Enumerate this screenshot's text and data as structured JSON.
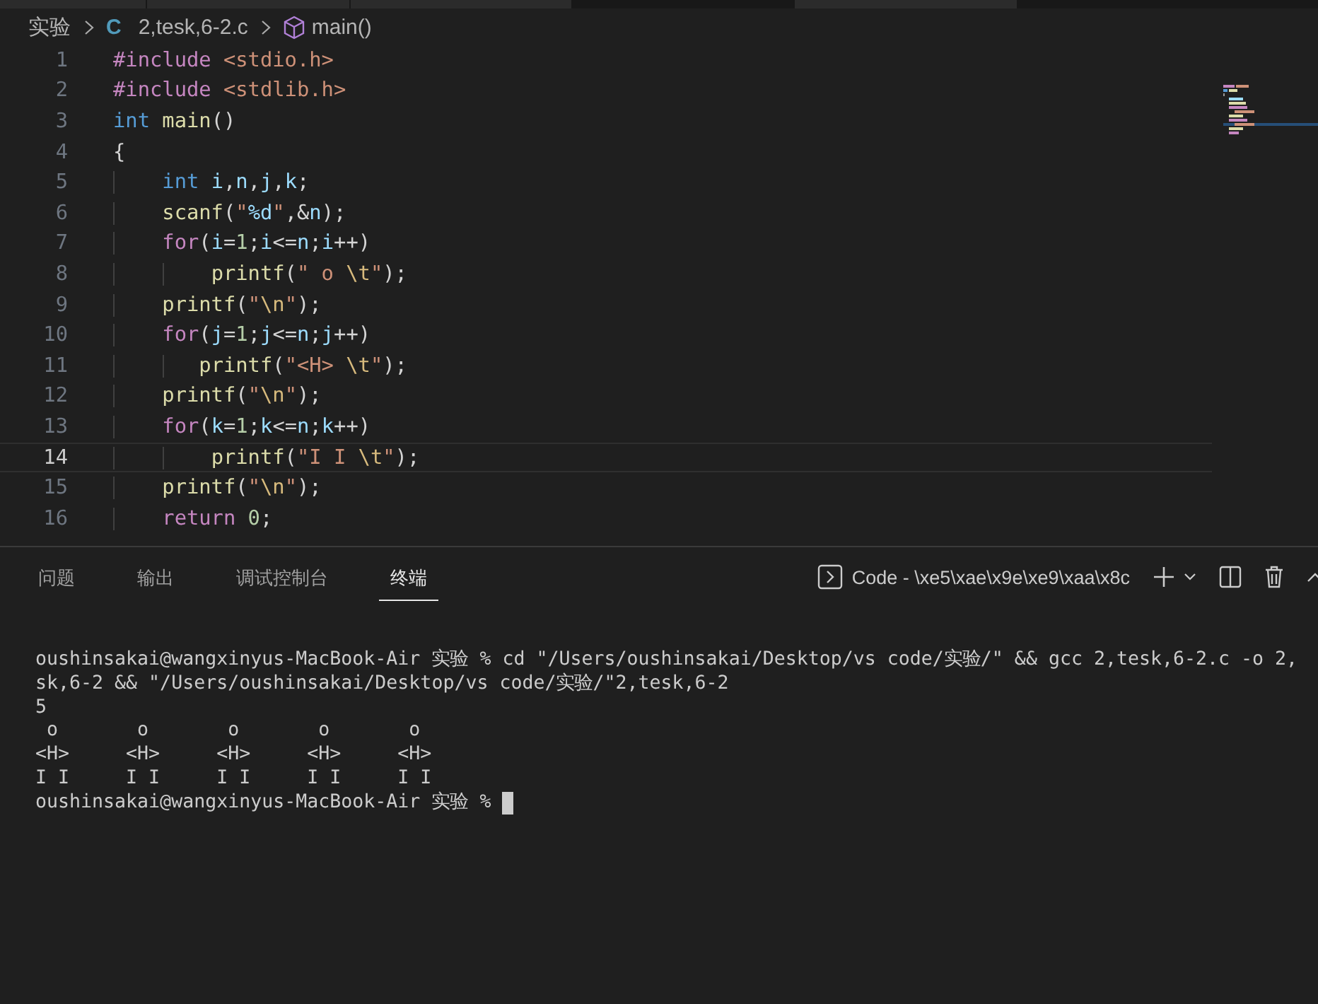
{
  "breadcrumb": {
    "folder": "实验",
    "file_icon": "C",
    "file": "2,tesk,6-2.c",
    "symbol": "main()"
  },
  "editor": {
    "lines": [
      {
        "number": "1",
        "current": false,
        "tokens": [
          {
            "kind": "directive",
            "text": "#include"
          },
          {
            "kind": "header",
            "text": " <stdio.h>"
          }
        ]
      },
      {
        "number": "2",
        "current": false,
        "tokens": [
          {
            "kind": "directive",
            "text": "#include"
          },
          {
            "kind": "header",
            "text": " <stdlib.h>"
          }
        ]
      },
      {
        "number": "3",
        "current": false,
        "tokens": [
          {
            "kind": "type",
            "text": "int"
          },
          {
            "kind": "func",
            "text": " main"
          },
          {
            "kind": "plain",
            "text": "()"
          }
        ]
      },
      {
        "number": "4",
        "current": false,
        "tokens": [
          {
            "kind": "plain",
            "text": "{"
          }
        ]
      },
      {
        "number": "5",
        "current": false,
        "tokens": [
          {
            "kind": "type",
            "text": "    int"
          },
          {
            "kind": "var",
            "text": " i"
          },
          {
            "kind": "plain",
            "text": ","
          },
          {
            "kind": "var",
            "text": "n"
          },
          {
            "kind": "plain",
            "text": ","
          },
          {
            "kind": "var",
            "text": "j"
          },
          {
            "kind": "plain",
            "text": ","
          },
          {
            "kind": "var",
            "text": "k"
          },
          {
            "kind": "plain",
            "text": ";"
          }
        ]
      },
      {
        "number": "6",
        "current": false,
        "tokens": [
          {
            "kind": "func",
            "text": "    scanf"
          },
          {
            "kind": "plain",
            "text": "("
          },
          {
            "kind": "string",
            "text": "\""
          },
          {
            "kind": "var",
            "text": "%d"
          },
          {
            "kind": "string",
            "text": "\""
          },
          {
            "kind": "plain",
            "text": ",&"
          },
          {
            "kind": "var",
            "text": "n"
          },
          {
            "kind": "plain",
            "text": ");"
          }
        ]
      },
      {
        "number": "7",
        "current": false,
        "tokens": [
          {
            "kind": "control",
            "text": "    for"
          },
          {
            "kind": "plain",
            "text": "("
          },
          {
            "kind": "var",
            "text": "i"
          },
          {
            "kind": "plain",
            "text": "="
          },
          {
            "kind": "number",
            "text": "1"
          },
          {
            "kind": "plain",
            "text": ";"
          },
          {
            "kind": "var",
            "text": "i"
          },
          {
            "kind": "plain",
            "text": "<="
          },
          {
            "kind": "var",
            "text": "n"
          },
          {
            "kind": "plain",
            "text": ";"
          },
          {
            "kind": "var",
            "text": "i"
          },
          {
            "kind": "plain",
            "text": "++)"
          }
        ]
      },
      {
        "number": "8",
        "current": false,
        "tokens": [
          {
            "kind": "func",
            "text": "        printf"
          },
          {
            "kind": "plain",
            "text": "("
          },
          {
            "kind": "string",
            "text": "\" o "
          },
          {
            "kind": "escape",
            "text": "\\t"
          },
          {
            "kind": "string",
            "text": "\""
          },
          {
            "kind": "plain",
            "text": ");"
          }
        ]
      },
      {
        "number": "9",
        "current": false,
        "tokens": [
          {
            "kind": "func",
            "text": "    printf"
          },
          {
            "kind": "plain",
            "text": "("
          },
          {
            "kind": "string",
            "text": "\""
          },
          {
            "kind": "escape",
            "text": "\\n"
          },
          {
            "kind": "string",
            "text": "\""
          },
          {
            "kind": "plain",
            "text": ");"
          }
        ]
      },
      {
        "number": "10",
        "current": false,
        "tokens": [
          {
            "kind": "control",
            "text": "    for"
          },
          {
            "kind": "plain",
            "text": "("
          },
          {
            "kind": "var",
            "text": "j"
          },
          {
            "kind": "plain",
            "text": "="
          },
          {
            "kind": "number",
            "text": "1"
          },
          {
            "kind": "plain",
            "text": ";"
          },
          {
            "kind": "var",
            "text": "j"
          },
          {
            "kind": "plain",
            "text": "<="
          },
          {
            "kind": "var",
            "text": "n"
          },
          {
            "kind": "plain",
            "text": ";"
          },
          {
            "kind": "var",
            "text": "j"
          },
          {
            "kind": "plain",
            "text": "++)"
          }
        ]
      },
      {
        "number": "11",
        "current": false,
        "tokens": [
          {
            "kind": "func",
            "text": "       printf"
          },
          {
            "kind": "plain",
            "text": "("
          },
          {
            "kind": "string",
            "text": "\"<H> "
          },
          {
            "kind": "escape",
            "text": "\\t"
          },
          {
            "kind": "string",
            "text": "\""
          },
          {
            "kind": "plain",
            "text": ");"
          }
        ]
      },
      {
        "number": "12",
        "current": false,
        "tokens": [
          {
            "kind": "func",
            "text": "    printf"
          },
          {
            "kind": "plain",
            "text": "("
          },
          {
            "kind": "string",
            "text": "\""
          },
          {
            "kind": "escape",
            "text": "\\n"
          },
          {
            "kind": "string",
            "text": "\""
          },
          {
            "kind": "plain",
            "text": ");"
          }
        ]
      },
      {
        "number": "13",
        "current": false,
        "tokens": [
          {
            "kind": "control",
            "text": "    for"
          },
          {
            "kind": "plain",
            "text": "("
          },
          {
            "kind": "var",
            "text": "k"
          },
          {
            "kind": "plain",
            "text": "="
          },
          {
            "kind": "number",
            "text": "1"
          },
          {
            "kind": "plain",
            "text": ";"
          },
          {
            "kind": "var",
            "text": "k"
          },
          {
            "kind": "plain",
            "text": "<="
          },
          {
            "kind": "var",
            "text": "n"
          },
          {
            "kind": "plain",
            "text": ";"
          },
          {
            "kind": "var",
            "text": "k"
          },
          {
            "kind": "plain",
            "text": "++)"
          }
        ]
      },
      {
        "number": "14",
        "current": true,
        "tokens": [
          {
            "kind": "func",
            "text": "        printf"
          },
          {
            "kind": "plain",
            "text": "("
          },
          {
            "kind": "string",
            "text": "\"I I "
          },
          {
            "kind": "escape",
            "text": "\\t"
          },
          {
            "kind": "string",
            "text": "\""
          },
          {
            "kind": "plain",
            "text": ");"
          }
        ]
      },
      {
        "number": "15",
        "current": false,
        "tokens": [
          {
            "kind": "func",
            "text": "    printf"
          },
          {
            "kind": "plain",
            "text": "("
          },
          {
            "kind": "string",
            "text": "\""
          },
          {
            "kind": "escape",
            "text": "\\n"
          },
          {
            "kind": "string",
            "text": "\""
          },
          {
            "kind": "plain",
            "text": ");"
          }
        ]
      },
      {
        "number": "16",
        "current": false,
        "tokens": [
          {
            "kind": "control",
            "text": "    return"
          },
          {
            "kind": "number",
            "text": " 0"
          },
          {
            "kind": "plain",
            "text": ";"
          }
        ]
      }
    ]
  },
  "panel": {
    "tabs": [
      {
        "label": "问题",
        "selected": false
      },
      {
        "label": "输出",
        "selected": false
      },
      {
        "label": "调试控制台",
        "selected": false
      },
      {
        "label": "终端",
        "selected": true
      }
    ],
    "terminal_title": "Code - \\xe5\\xae\\x9e\\xe9\\xaa\\x8c",
    "terminal_lines": [
      {
        "text": "oushinsakai@wangxinyus-MacBook-Air 实验 % cd \"/Users/oushinsakai/Desktop/vs code/实验/\" && gcc 2,tesk,6-2.c -o 2,",
        "cursor": false
      },
      {
        "text": "sk,6-2 && \"/Users/oushinsakai/Desktop/vs code/实验/\"2,tesk,6-2",
        "cursor": false
      },
      {
        "text": "5",
        "cursor": false
      },
      {
        "text": " o       o       o       o       o",
        "cursor": false
      },
      {
        "text": "<H>     <H>     <H>     <H>     <H>",
        "cursor": false
      },
      {
        "text": "I I     I I     I I     I I     I I",
        "cursor": false
      },
      {
        "text": "oushinsakai@wangxinyus-MacBook-Air 实验 %",
        "cursor": true
      }
    ]
  }
}
